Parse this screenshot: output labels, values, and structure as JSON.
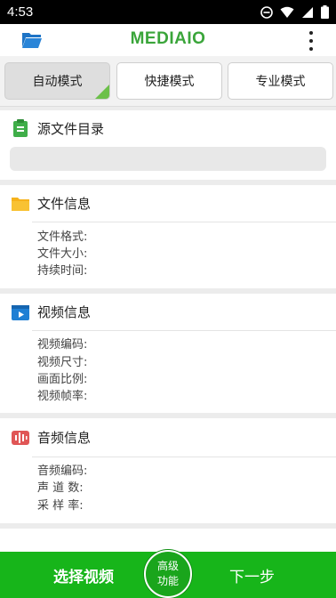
{
  "status_bar": {
    "time": "4:53"
  },
  "app_bar": {
    "title": "MEDIAIO"
  },
  "tabs": [
    {
      "label": "自动模式",
      "active": true
    },
    {
      "label": "快捷模式",
      "active": false
    },
    {
      "label": "专业模式",
      "active": false
    }
  ],
  "source": {
    "heading": "源文件目录",
    "path": ""
  },
  "file_info": {
    "heading": "文件信息",
    "fields": [
      "文件格式:",
      "文件大小:",
      "持续时间:"
    ]
  },
  "video_info": {
    "heading": "视频信息",
    "fields": [
      "视频编码:",
      "视频尺寸:",
      "画面比例:",
      "视频帧率:"
    ]
  },
  "audio_info": {
    "heading": "音频信息",
    "fields": [
      "音频编码:",
      "声 道 数:",
      "采 样 率:"
    ]
  },
  "bottom": {
    "select_video": "选择视频",
    "advanced_line1": "高级",
    "advanced_line2": "功能",
    "next": "下一步"
  },
  "colors": {
    "accent": "#17b51a",
    "title_green": "#3aa53a",
    "folder_blue": "#1e74c6"
  },
  "icons": [
    "dnd-icon",
    "wifi-icon",
    "cellular-icon",
    "battery-icon",
    "folder-open-icon",
    "overflow-menu-icon",
    "clipboard-icon",
    "folder-icon",
    "video-clip-icon",
    "audio-wave-icon",
    "check-corner-icon"
  ]
}
